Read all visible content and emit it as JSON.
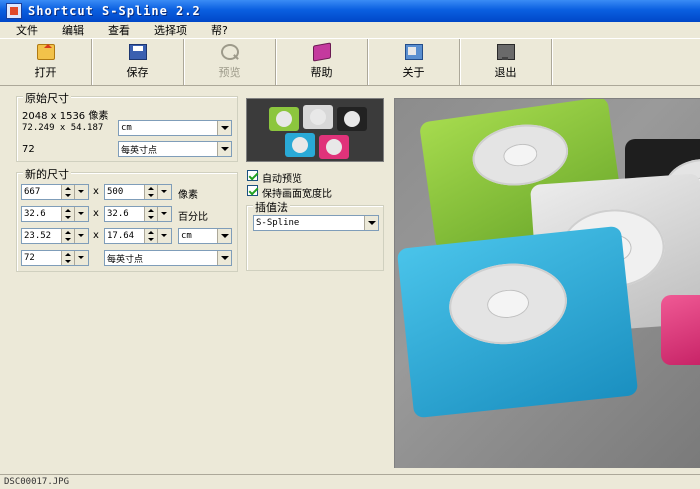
{
  "window": {
    "title": "Shortcut S-Spline 2.2"
  },
  "menu": [
    "文件",
    "编辑",
    "查看",
    "选择项",
    "帮?"
  ],
  "toolbar": [
    {
      "id": "open",
      "label": "打开",
      "icon": "folder-open-icon",
      "enabled": true
    },
    {
      "id": "save",
      "label": "保存",
      "icon": "floppy-disk-icon",
      "enabled": true
    },
    {
      "id": "preview",
      "label": "预览",
      "icon": "magnifier-icon",
      "enabled": false
    },
    {
      "id": "help",
      "label": "帮助",
      "icon": "help-book-icon",
      "enabled": true
    },
    {
      "id": "about",
      "label": "关于",
      "icon": "about-icon",
      "enabled": true
    },
    {
      "id": "exit",
      "label": "退出",
      "icon": "exit-monitor-icon",
      "enabled": true
    }
  ],
  "original": {
    "title": "原始尺寸",
    "pixels": "2048 x 1536 像素",
    "size": "72.249 x 54.187",
    "unit": "cm",
    "dpi": "72",
    "dpi_unit": "每英寸点"
  },
  "newsize": {
    "title": "新的尺寸",
    "width_px": "667",
    "height_px": "500",
    "px_label": "像素",
    "width_pct": "32.6",
    "height_pct": "32.6",
    "pct_label": "百分比",
    "width_cm": "23.52",
    "height_cm": "17.64",
    "unit": "cm",
    "dpi": "72",
    "dpi_unit": "每英寸点",
    "x": "x"
  },
  "options": {
    "auto_preview": "自动预览",
    "keep_aspect": "保持画面宽度比",
    "interp_title": "插值法",
    "interp_value": "S-Spline"
  },
  "status": {
    "filename": "DSC00017.JPG"
  },
  "colors": {
    "titlebar": "#0a5fe0",
    "face": "#ece9d8",
    "ipod_green": "#8cc63e",
    "ipod_blue": "#29a9d6",
    "ipod_pink": "#e0337a",
    "ipod_black": "#2a2a2a",
    "ipod_silver": "#d8d8d8"
  }
}
